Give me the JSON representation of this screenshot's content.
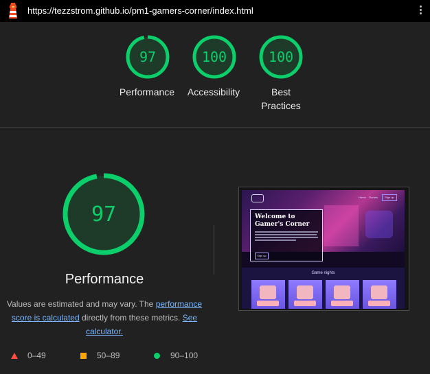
{
  "browser": {
    "url": "https://tezzstrom.github.io/pm1-gamers-corner/index.html",
    "logo_icon": "lighthouse-icon",
    "menu_icon": "kebab-menu-icon"
  },
  "scores": [
    {
      "label": "Performance",
      "score": "97"
    },
    {
      "label": "Accessibility",
      "score": "100"
    },
    {
      "label": "Best Practices",
      "label_line1": "Best",
      "label_line2": "Practices",
      "score": "100"
    }
  ],
  "performance": {
    "score": "97",
    "title": "Performance",
    "desc_prefix": "Values are estimated and may vary. The",
    "desc_link1": "performance score is calculated",
    "desc_middle": "directly from these metrics.",
    "desc_link2": "See calculator."
  },
  "legend": [
    {
      "range": "0–49",
      "shape": "triangle",
      "color": "#ff4e42"
    },
    {
      "range": "50–89",
      "shape": "square",
      "color": "#ffa400"
    },
    {
      "range": "90–100",
      "shape": "circle",
      "color": "#0cce6b"
    }
  ],
  "screenshot": {
    "nav_links": [
      "Home",
      "Games"
    ],
    "nav_button": "Sign up",
    "hero_title": "Welcome to Gamer's Corner",
    "hero_button": "Sign up",
    "section_title": "Game nights"
  },
  "colors": {
    "pass": "#0cce6b",
    "pass_bg": "#1e3b2a",
    "background": "#212121"
  }
}
